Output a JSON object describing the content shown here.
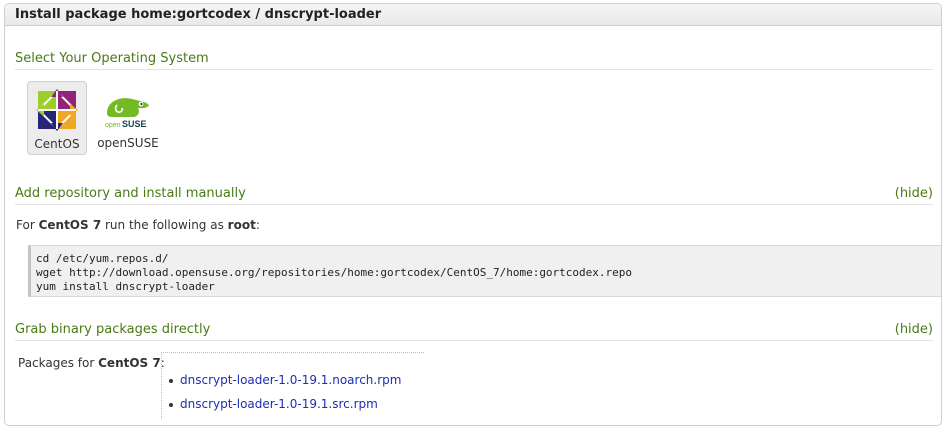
{
  "header": {
    "title": "Install package home:gortcodex / dnscrypt-loader"
  },
  "os_section": {
    "title": "Select Your Operating System",
    "items": [
      {
        "label": "CentOS",
        "icon": "centos-logo-icon",
        "selected": true
      },
      {
        "label": "openSUSE",
        "icon": "opensuse-logo-icon",
        "selected": false
      }
    ]
  },
  "repo_section": {
    "title": "Add repository and install manually",
    "hide_label": "(hide)",
    "instr": {
      "prefix": "For ",
      "os": "CentOS 7",
      "middle": " run the following as ",
      "user": "root",
      "suffix": ":"
    },
    "code": "cd /etc/yum.repos.d/\nwget http://download.opensuse.org/repositories/home:gortcodex/CentOS_7/home:gortcodex.repo\nyum install dnscrypt-loader"
  },
  "binary_section": {
    "title": "Grab binary packages directly",
    "hide_label": "(hide)",
    "packages_prefix": "Packages for ",
    "packages_os": "CentOS 7",
    "packages_suffix": ":",
    "packages": [
      "dnscrypt-loader-1.0-19.1.noarch.rpm",
      "dnscrypt-loader-1.0-19.1.src.rpm"
    ]
  }
}
